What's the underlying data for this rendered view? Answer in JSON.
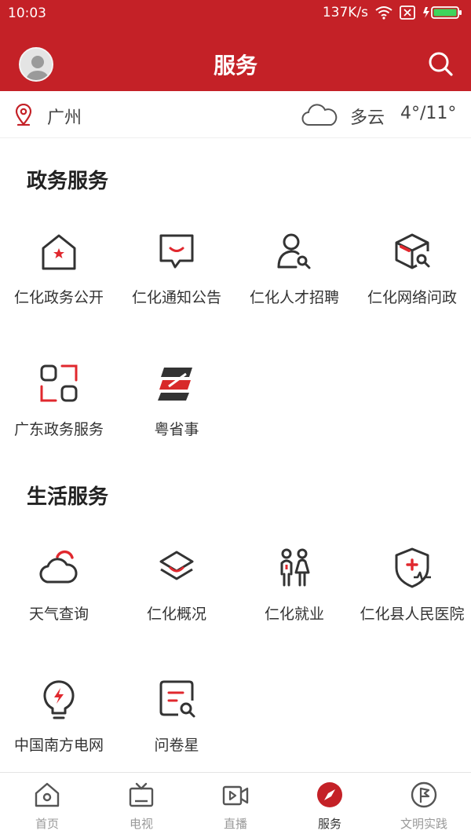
{
  "status": {
    "time": "10:03",
    "speed": "137K/s"
  },
  "header": {
    "title": "服务"
  },
  "location": {
    "city": "广州",
    "weather": "多云",
    "temp": "4°/11°"
  },
  "sections": {
    "gov": {
      "title": "政务服务",
      "items": [
        {
          "label": "仁化政务公开",
          "icon": "building-star-icon"
        },
        {
          "label": "仁化通知公告",
          "icon": "message-icon"
        },
        {
          "label": "仁化人才招聘",
          "icon": "person-search-icon"
        },
        {
          "label": "仁化网络问政",
          "icon": "box-search-icon"
        },
        {
          "label": "广东政务服务",
          "icon": "apps-icon"
        },
        {
          "label": "粤省事",
          "icon": "yue-logo-icon"
        }
      ]
    },
    "life": {
      "title": "生活服务",
      "items": [
        {
          "label": "天气查询",
          "icon": "cloud-sun-icon"
        },
        {
          "label": "仁化概况",
          "icon": "layers-icon"
        },
        {
          "label": "仁化就业",
          "icon": "people-icon"
        },
        {
          "label": "仁化县人民医院",
          "icon": "medical-shield-icon"
        },
        {
          "label": "中国南方电网",
          "icon": "bulb-icon"
        },
        {
          "label": "问卷星",
          "icon": "survey-icon"
        }
      ]
    }
  },
  "tabs": [
    {
      "label": "首页",
      "icon": "home-icon"
    },
    {
      "label": "电视",
      "icon": "tv-icon"
    },
    {
      "label": "直播",
      "icon": "live-icon"
    },
    {
      "label": "服务",
      "icon": "compass-icon",
      "active": true
    },
    {
      "label": "文明实践",
      "icon": "flag-icon"
    }
  ],
  "colors": {
    "brand": "#c42127",
    "icon_dark": "#333333",
    "accent": "#e0282e"
  }
}
